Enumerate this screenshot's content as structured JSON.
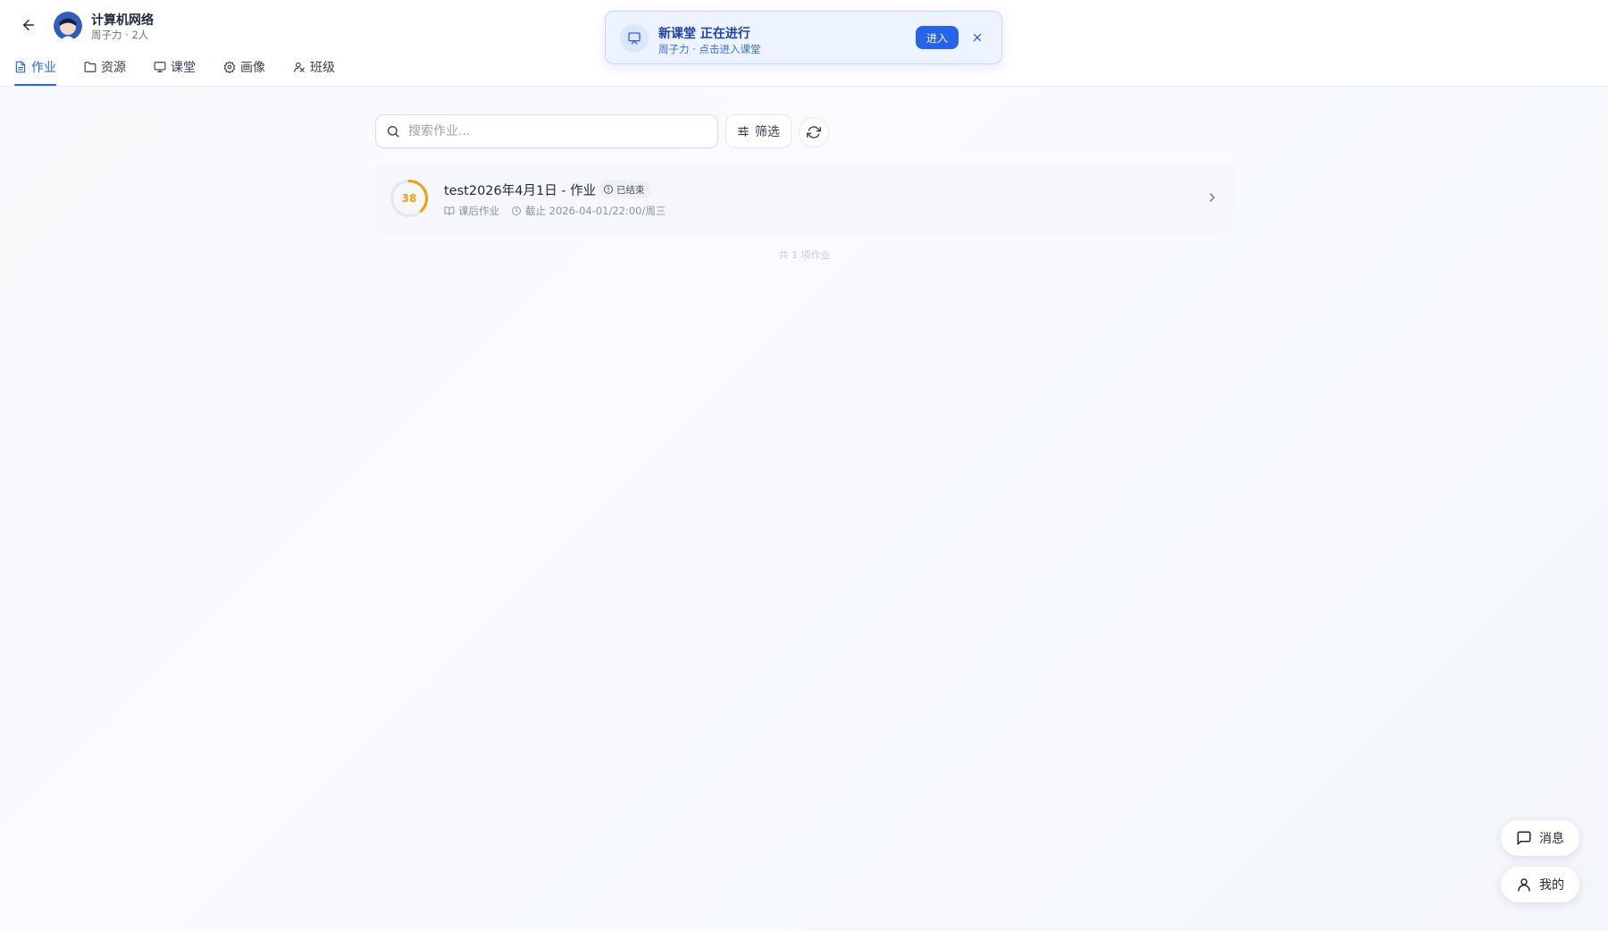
{
  "header": {
    "course_title": "计算机网络",
    "course_sub": "周子力 · 2人"
  },
  "tabs": [
    {
      "label": "作业",
      "icon": "file-icon",
      "active": true
    },
    {
      "label": "资源",
      "icon": "folder-icon",
      "active": false
    },
    {
      "label": "课堂",
      "icon": "monitor-icon",
      "active": false
    },
    {
      "label": "画像",
      "icon": "badge-icon",
      "active": false
    },
    {
      "label": "班级",
      "icon": "people-icon",
      "active": false
    }
  ],
  "toast": {
    "title": "新课堂 正在进行",
    "sub": "周子力 · 点击进入课堂",
    "enter_label": "进入"
  },
  "search": {
    "placeholder": "搜索作业..."
  },
  "toolbar": {
    "filter_label": "筛选"
  },
  "homework": [
    {
      "score": "38",
      "score_fraction": 0.38,
      "title": "test2026年4月1日 - 作业",
      "status": "已结束",
      "type": "课后作业",
      "deadline": "截止 2026-04-01/22:00/周三"
    }
  ],
  "total": "共 1 项作业",
  "floating": {
    "messages_label": "消息",
    "me_label": "我的"
  },
  "colors": {
    "accent": "#2563eb",
    "score": "#f59e0b"
  }
}
